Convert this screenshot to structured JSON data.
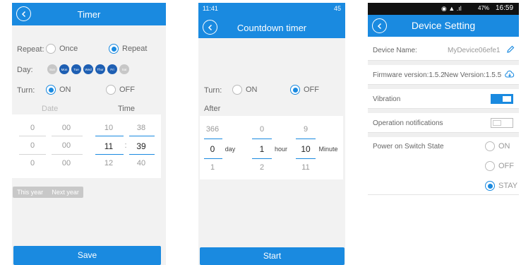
{
  "timer": {
    "title": "Timer",
    "repeat_label": "Repeat:",
    "once_label": "Once",
    "repeat_option": "Repeat",
    "day_label": "Day:",
    "days": [
      "Sun",
      "Mon",
      "Tue",
      "Wed",
      "Thur",
      "Fri",
      "Sat"
    ],
    "turn_label": "Turn:",
    "on_label": "ON",
    "off_label": "OFF",
    "date_header": "Date",
    "time_header": "Time",
    "date_col1": [
      "0",
      "0",
      "0"
    ],
    "date_col2": [
      "00",
      "00",
      "00"
    ],
    "time_hour": [
      "10",
      "11",
      "12"
    ],
    "time_sep": ":",
    "time_min": [
      "38",
      "39",
      "40"
    ],
    "this_year": "This year",
    "next_year": "Next year",
    "save_label": "Save"
  },
  "countdown": {
    "status_time": "11:41",
    "status_right": "45",
    "title": "Countdown timer",
    "turn_label": "Turn:",
    "on_label": "ON",
    "off_label": "OFF",
    "after_label": "After",
    "day_col": [
      "366",
      "0",
      "1"
    ],
    "day_unit": "day",
    "hour_col": [
      "0",
      "1",
      "2"
    ],
    "hour_unit": "hour",
    "min_col": [
      "9",
      "10",
      "11"
    ],
    "min_unit": "Minute",
    "start_label": "Start"
  },
  "device": {
    "status_right": "47%",
    "status_time": "16:59",
    "title": "Device Setting",
    "device_name_label": "Device Name:",
    "device_name_value": "MyDevice06efe1",
    "firmware_label": "Firmware version:1.5.2",
    "new_version_label": "New Version:1.5.5",
    "vibration_label": "Vibration",
    "notifications_label": "Operation notifications",
    "power_label": "Power on Switch State",
    "power_on": "ON",
    "power_off": "OFF",
    "power_stay": "STAY",
    "accent": "#1a8ae0"
  }
}
